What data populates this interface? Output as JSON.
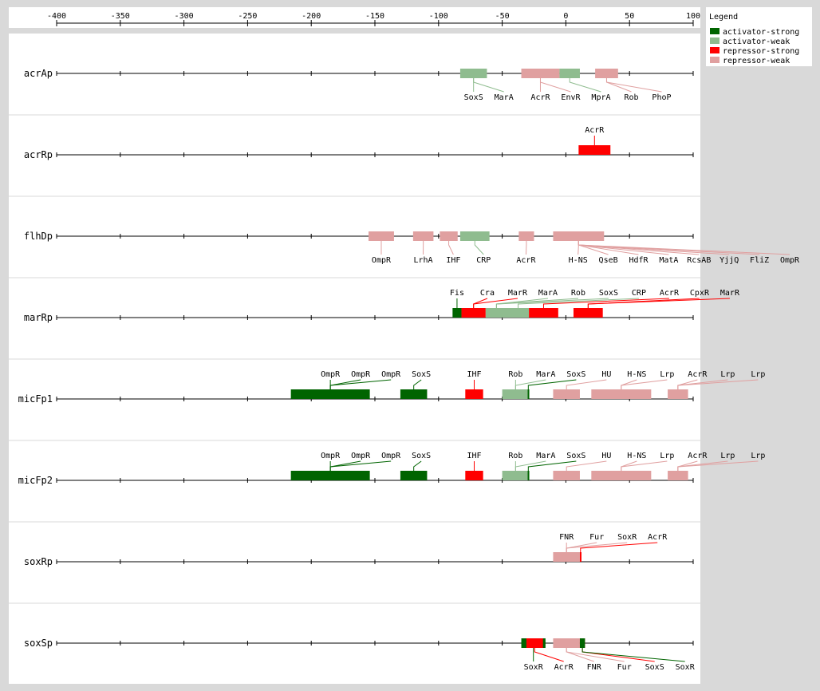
{
  "axis": {
    "ticks": [
      "-400",
      "-350",
      "-300",
      "-250",
      "-200",
      "-150",
      "-100",
      "-50",
      "0",
      "50",
      "100"
    ],
    "range": [
      -400,
      100
    ]
  },
  "legend": {
    "title": "Legend",
    "items": [
      {
        "key": "activator-strong",
        "label": "activator-strong",
        "color": "#006400"
      },
      {
        "key": "activator-weak",
        "label": "activator-weak",
        "color": "#8fbc8f"
      },
      {
        "key": "repressor-strong",
        "label": "repressor-strong",
        "color": "#ff0000"
      },
      {
        "key": "repressor-weak",
        "label": "repressor-weak",
        "color": "#e0a0a0"
      }
    ]
  },
  "promoters": [
    {
      "name": "acrAp",
      "sites": [
        {
          "tf": "SoxS",
          "type": "activator-weak",
          "start": -83,
          "end": -62,
          "side": "below"
        },
        {
          "tf": "MarA",
          "type": "activator-weak",
          "start": -83,
          "end": -62,
          "side": "below"
        },
        {
          "tf": "AcrR",
          "type": "repressor-weak",
          "start": -35,
          "end": -5,
          "side": "below"
        },
        {
          "tf": "EnvR",
          "type": "repressor-weak",
          "start": -35,
          "end": -5,
          "side": "below"
        },
        {
          "tf": "MprA",
          "type": "activator-weak",
          "start": -5,
          "end": 11,
          "side": "below"
        },
        {
          "tf": "Rob",
          "type": "repressor-weak",
          "start": 23,
          "end": 41,
          "side": "below"
        },
        {
          "tf": "PhoP",
          "type": "repressor-weak",
          "start": 23,
          "end": 41,
          "side": "below"
        }
      ]
    },
    {
      "name": "acrRp",
      "sites": [
        {
          "tf": "AcrR",
          "type": "repressor-strong",
          "start": 10,
          "end": 35,
          "side": "above"
        }
      ]
    },
    {
      "name": "flhDp",
      "sites": [
        {
          "tf": "OmpR",
          "type": "repressor-weak",
          "start": -155,
          "end": -135,
          "side": "below"
        },
        {
          "tf": "LrhA",
          "type": "repressor-weak",
          "start": -120,
          "end": -104,
          "side": "below"
        },
        {
          "tf": "IHF",
          "type": "repressor-weak",
          "start": -99,
          "end": -85,
          "side": "below"
        },
        {
          "tf": "CRP",
          "type": "activator-weak",
          "start": -83,
          "end": -60,
          "side": "below"
        },
        {
          "tf": "AcrR",
          "type": "repressor-weak",
          "start": -37,
          "end": -25,
          "side": "below"
        },
        {
          "tf": "H-NS",
          "type": "repressor-weak",
          "start": -10,
          "end": 30,
          "side": "below"
        },
        {
          "tf": "QseB",
          "type": "repressor-weak",
          "start": -10,
          "end": 30,
          "side": "below"
        },
        {
          "tf": "HdfR",
          "type": "repressor-weak",
          "start": -10,
          "end": 30,
          "side": "below"
        },
        {
          "tf": "MatA",
          "type": "repressor-weak",
          "start": -10,
          "end": 30,
          "side": "below"
        },
        {
          "tf": "RcsAB",
          "type": "repressor-weak",
          "start": -10,
          "end": 30,
          "side": "below"
        },
        {
          "tf": "YjjQ",
          "type": "repressor-weak",
          "start": -10,
          "end": 30,
          "side": "below"
        },
        {
          "tf": "FliZ",
          "type": "repressor-weak",
          "start": -10,
          "end": 30,
          "side": "below"
        },
        {
          "tf": "OmpR",
          "type": "repressor-weak",
          "start": -10,
          "end": 30,
          "side": "below"
        }
      ]
    },
    {
      "name": "marRp",
      "sites": [
        {
          "tf": "Fis",
          "type": "activator-strong",
          "start": -89,
          "end": -82,
          "side": "above"
        },
        {
          "tf": "Cra",
          "type": "repressor-strong",
          "start": -82,
          "end": -63,
          "side": "above"
        },
        {
          "tf": "MarA",
          "type": "activator-weak",
          "start": -63,
          "end": -46,
          "side": "above"
        },
        {
          "tf": "Rob",
          "type": "activator-weak",
          "start": -63,
          "end": -46,
          "side": "above"
        },
        {
          "tf": "SoxS",
          "type": "activator-weak",
          "start": -63,
          "end": -46,
          "side": "above"
        },
        {
          "tf": "CRP",
          "type": "activator-weak",
          "start": -46,
          "end": -29,
          "side": "above"
        },
        {
          "tf": "AcrR",
          "type": "repressor-strong",
          "start": -29,
          "end": -6,
          "side": "above"
        },
        {
          "tf": "CpxR",
          "type": "repressor-strong",
          "start": 6,
          "end": 29,
          "side": "above"
        },
        {
          "tf": "MarR",
          "type": "repressor-strong",
          "start": 6,
          "end": 29,
          "side": "above"
        },
        {
          "tf": "MarR",
          "type": "repressor-strong",
          "start": -82,
          "end": -63,
          "side": "above"
        }
      ]
    },
    {
      "name": "micFp1",
      "sites": [
        {
          "tf": "OmpR",
          "type": "activator-strong",
          "start": -216,
          "end": -154,
          "side": "above"
        },
        {
          "tf": "OmpR",
          "type": "activator-strong",
          "start": -216,
          "end": -154,
          "side": "above"
        },
        {
          "tf": "OmpR",
          "type": "activator-strong",
          "start": -216,
          "end": -154,
          "side": "above"
        },
        {
          "tf": "SoxS",
          "type": "activator-strong",
          "start": -130,
          "end": -109,
          "side": "above"
        },
        {
          "tf": "IHF",
          "type": "repressor-strong",
          "start": -79,
          "end": -65,
          "side": "above"
        },
        {
          "tf": "Rob",
          "type": "activator-weak",
          "start": -50,
          "end": -29,
          "side": "above"
        },
        {
          "tf": "MarA",
          "type": "activator-weak",
          "start": -50,
          "end": -29,
          "side": "above"
        },
        {
          "tf": "SoxS",
          "type": "activator-strong",
          "start": -30,
          "end": -29,
          "side": "above"
        },
        {
          "tf": "HU",
          "type": "repressor-weak",
          "start": -10,
          "end": 11,
          "side": "above"
        },
        {
          "tf": "H-NS",
          "type": "repressor-weak",
          "start": 20,
          "end": 67,
          "side": "above"
        },
        {
          "tf": "Lrp",
          "type": "repressor-weak",
          "start": 20,
          "end": 67,
          "side": "above"
        },
        {
          "tf": "AcrR",
          "type": "repressor-weak",
          "start": 80,
          "end": 96,
          "side": "above"
        },
        {
          "tf": "Lrp",
          "type": "repressor-weak",
          "start": 80,
          "end": 96,
          "side": "above"
        },
        {
          "tf": "Lrp",
          "type": "repressor-weak",
          "start": 80,
          "end": 96,
          "side": "above"
        }
      ]
    },
    {
      "name": "micFp2",
      "sites": [
        {
          "tf": "OmpR",
          "type": "activator-strong",
          "start": -216,
          "end": -154,
          "side": "above"
        },
        {
          "tf": "OmpR",
          "type": "activator-strong",
          "start": -216,
          "end": -154,
          "side": "above"
        },
        {
          "tf": "OmpR",
          "type": "activator-strong",
          "start": -216,
          "end": -154,
          "side": "above"
        },
        {
          "tf": "SoxS",
          "type": "activator-strong",
          "start": -130,
          "end": -109,
          "side": "above"
        },
        {
          "tf": "IHF",
          "type": "repressor-strong",
          "start": -79,
          "end": -65,
          "side": "above"
        },
        {
          "tf": "Rob",
          "type": "activator-weak",
          "start": -50,
          "end": -29,
          "side": "above"
        },
        {
          "tf": "MarA",
          "type": "activator-weak",
          "start": -50,
          "end": -29,
          "side": "above"
        },
        {
          "tf": "SoxS",
          "type": "activator-strong",
          "start": -30,
          "end": -29,
          "side": "above"
        },
        {
          "tf": "HU",
          "type": "repressor-weak",
          "start": -10,
          "end": 11,
          "side": "above"
        },
        {
          "tf": "H-NS",
          "type": "repressor-weak",
          "start": 20,
          "end": 67,
          "side": "above"
        },
        {
          "tf": "Lrp",
          "type": "repressor-weak",
          "start": 20,
          "end": 67,
          "side": "above"
        },
        {
          "tf": "AcrR",
          "type": "repressor-weak",
          "start": 80,
          "end": 96,
          "side": "above"
        },
        {
          "tf": "Lrp",
          "type": "repressor-weak",
          "start": 80,
          "end": 96,
          "side": "above"
        },
        {
          "tf": "Lrp",
          "type": "repressor-weak",
          "start": 80,
          "end": 96,
          "side": "above"
        }
      ]
    },
    {
      "name": "soxRp",
      "sites": [
        {
          "tf": "FNR",
          "type": "repressor-weak",
          "start": -10,
          "end": 11,
          "side": "above"
        },
        {
          "tf": "Fur",
          "type": "repressor-weak",
          "start": -10,
          "end": 11,
          "side": "above"
        },
        {
          "tf": "SoxR",
          "type": "repressor-weak",
          "start": -10,
          "end": 11,
          "side": "above"
        },
        {
          "tf": "AcrR",
          "type": "repressor-strong",
          "start": 11,
          "end": 12,
          "side": "above"
        }
      ]
    },
    {
      "name": "soxSp",
      "sites": [
        {
          "tf": "SoxR",
          "type": "activator-strong",
          "start": -35,
          "end": -16,
          "side": "below"
        },
        {
          "tf": "AcrR",
          "type": "repressor-strong",
          "start": -31,
          "end": -18,
          "side": "below"
        },
        {
          "tf": "FNR",
          "type": "repressor-weak",
          "start": -10,
          "end": 11,
          "side": "below"
        },
        {
          "tf": "Fur",
          "type": "repressor-weak",
          "start": -10,
          "end": 11,
          "side": "below"
        },
        {
          "tf": "SoxS",
          "type": "repressor-strong",
          "start": 11,
          "end": 15,
          "side": "below"
        },
        {
          "tf": "SoxR",
          "type": "activator-strong",
          "start": 11,
          "end": 15,
          "side": "below"
        }
      ]
    }
  ]
}
